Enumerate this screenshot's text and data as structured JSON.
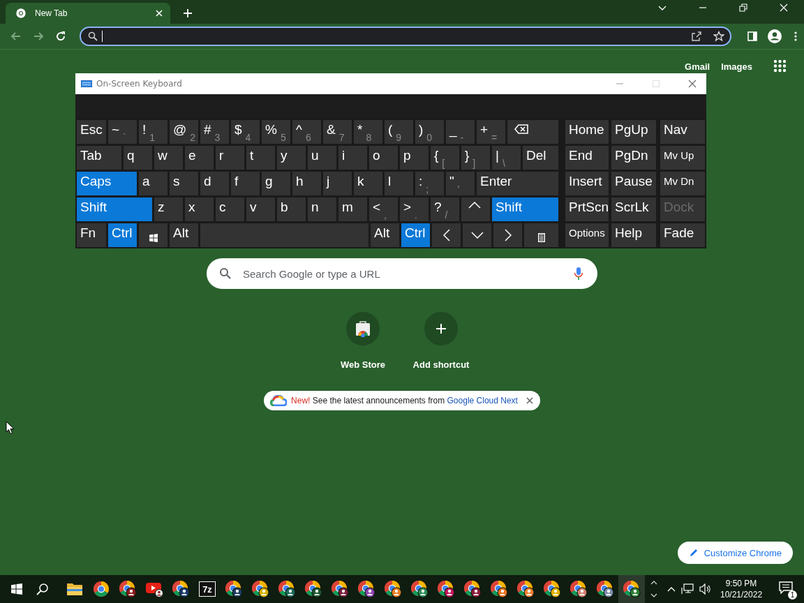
{
  "browser": {
    "tabs": [
      {
        "title": "New Tab",
        "selected": true
      }
    ]
  },
  "new_tab_page": {
    "header_links": [
      "Gmail",
      "Images"
    ],
    "search": {
      "placeholder": "Search Google or type a URL"
    },
    "shortcuts": [
      {
        "label": "Web Store",
        "kind": "webstore"
      },
      {
        "label": "Add shortcut",
        "kind": "add"
      }
    ],
    "promo": {
      "badge": "New!",
      "text": "See the latest announcements from",
      "link": "Google Cloud Next"
    },
    "customize_button": "Customize Chrome"
  },
  "on_screen_keyboard": {
    "title": "On-Screen Keyboard",
    "rows": [
      {
        "keys": [
          {
            "kind": "text",
            "label": "Esc",
            "pressed": false
          },
          {
            "kind": "text",
            "label": "~",
            "sub": "`",
            "pressed": false
          },
          {
            "kind": "text",
            "label": "!",
            "sub": "1",
            "pressed": false
          },
          {
            "kind": "text",
            "label": "@",
            "sub": "2",
            "pressed": false
          },
          {
            "kind": "text",
            "label": "#",
            "sub": "3",
            "pressed": false
          },
          {
            "kind": "text",
            "label": "$",
            "sub": "4",
            "pressed": false
          },
          {
            "kind": "text",
            "label": "%",
            "sub": "5",
            "pressed": false
          },
          {
            "kind": "text",
            "label": "^",
            "sub": "6",
            "pressed": false
          },
          {
            "kind": "text",
            "label": "&",
            "sub": "7",
            "pressed": false
          },
          {
            "kind": "text",
            "label": "*",
            "sub": "8",
            "pressed": false
          },
          {
            "kind": "text",
            "label": "(",
            "sub": "9",
            "pressed": false
          },
          {
            "kind": "text",
            "label": ")",
            "sub": "0",
            "pressed": false
          },
          {
            "kind": "text",
            "label": "_",
            "sub": "-",
            "pressed": false
          },
          {
            "kind": "text",
            "label": "+",
            "sub": "=",
            "pressed": false
          },
          {
            "kind": "backspace",
            "pressed": false
          }
        ]
      },
      {
        "keys": [
          {
            "kind": "text",
            "label": "Tab",
            "pressed": false
          },
          {
            "kind": "text",
            "label": "q",
            "pressed": false
          },
          {
            "kind": "text",
            "label": "w",
            "pressed": false
          },
          {
            "kind": "text",
            "label": "e",
            "pressed": false
          },
          {
            "kind": "text",
            "label": "r",
            "pressed": false
          },
          {
            "kind": "text",
            "label": "t",
            "pressed": false
          },
          {
            "kind": "text",
            "label": "y",
            "pressed": false
          },
          {
            "kind": "text",
            "label": "u",
            "pressed": false
          },
          {
            "kind": "text",
            "label": "i",
            "pressed": false
          },
          {
            "kind": "text",
            "label": "o",
            "pressed": false
          },
          {
            "kind": "text",
            "label": "p",
            "pressed": false
          },
          {
            "kind": "text",
            "label": "{",
            "sub": "[",
            "pressed": false
          },
          {
            "kind": "text",
            "label": "}",
            "sub": "]",
            "pressed": false
          },
          {
            "kind": "text",
            "label": "|",
            "sub": "\\",
            "pressed": false
          },
          {
            "kind": "text",
            "label": "Del",
            "pressed": false
          }
        ]
      },
      {
        "keys": [
          {
            "kind": "text",
            "label": "Caps",
            "pressed": true
          },
          {
            "kind": "text",
            "label": "a",
            "pressed": false
          },
          {
            "kind": "text",
            "label": "s",
            "pressed": false
          },
          {
            "kind": "text",
            "label": "d",
            "pressed": false
          },
          {
            "kind": "text",
            "label": "f",
            "pressed": false
          },
          {
            "kind": "text",
            "label": "g",
            "pressed": false
          },
          {
            "kind": "text",
            "label": "h",
            "pressed": false
          },
          {
            "kind": "text",
            "label": "j",
            "pressed": false
          },
          {
            "kind": "text",
            "label": "k",
            "pressed": false
          },
          {
            "kind": "text",
            "label": "l",
            "pressed": false
          },
          {
            "kind": "text",
            "label": ":",
            "sub": ";",
            "pressed": false
          },
          {
            "kind": "text",
            "label": "\"",
            "sub": "'",
            "pressed": false
          },
          {
            "kind": "text",
            "label": "Enter",
            "pressed": false
          }
        ]
      },
      {
        "keys": [
          {
            "kind": "text",
            "label": "Shift",
            "pressed": true
          },
          {
            "kind": "text",
            "label": "z",
            "pressed": false
          },
          {
            "kind": "text",
            "label": "x",
            "pressed": false
          },
          {
            "kind": "text",
            "label": "c",
            "pressed": false
          },
          {
            "kind": "text",
            "label": "v",
            "pressed": false
          },
          {
            "kind": "text",
            "label": "b",
            "pressed": false
          },
          {
            "kind": "text",
            "label": "n",
            "pressed": false
          },
          {
            "kind": "text",
            "label": "m",
            "pressed": false
          },
          {
            "kind": "text",
            "label": "<",
            "sub": ",",
            "pressed": false
          },
          {
            "kind": "text",
            "label": ">",
            "sub": ".",
            "pressed": false
          },
          {
            "kind": "text",
            "label": "?",
            "sub": "/",
            "pressed": false
          },
          {
            "kind": "up",
            "pressed": false
          },
          {
            "kind": "text",
            "label": "Shift",
            "pressed": true
          }
        ]
      },
      {
        "keys": [
          {
            "kind": "text",
            "label": "Fn",
            "pressed": false
          },
          {
            "kind": "text",
            "label": "Ctrl",
            "pressed": true
          },
          {
            "kind": "windows",
            "pressed": false
          },
          {
            "kind": "text",
            "label": "Alt",
            "pressed": false
          },
          {
            "kind": "space",
            "pressed": false
          },
          {
            "kind": "text",
            "label": "Alt",
            "pressed": false
          },
          {
            "kind": "text",
            "label": "Ctrl",
            "pressed": true
          },
          {
            "kind": "left",
            "pressed": false
          },
          {
            "kind": "down",
            "pressed": false
          },
          {
            "kind": "right",
            "pressed": false
          },
          {
            "kind": "menu",
            "pressed": false
          }
        ]
      }
    ],
    "nav_rows": [
      [
        {
          "kind": "text",
          "label": "Home",
          "disabled": false
        },
        {
          "kind": "text",
          "label": "PgUp",
          "disabled": false
        },
        {
          "kind": "text",
          "label": "Nav",
          "disabled": false
        }
      ],
      [
        {
          "kind": "text",
          "label": "End",
          "disabled": false
        },
        {
          "kind": "text",
          "label": "PgDn",
          "disabled": false
        },
        {
          "kind": "small",
          "label": "Mv Up",
          "disabled": false
        }
      ],
      [
        {
          "kind": "text",
          "label": "Insert",
          "disabled": false
        },
        {
          "kind": "text",
          "label": "Pause",
          "disabled": false
        },
        {
          "kind": "small",
          "label": "Mv Dn",
          "disabled": false
        }
      ],
      [
        {
          "kind": "text",
          "label": "PrtScn",
          "disabled": false
        },
        {
          "kind": "text",
          "label": "ScrLk",
          "disabled": false
        },
        {
          "kind": "text",
          "label": "Dock",
          "disabled": true
        }
      ],
      [
        {
          "kind": "small",
          "label": "Options",
          "disabled": false
        },
        {
          "kind": "text",
          "label": "Help",
          "disabled": false
        },
        {
          "kind": "text",
          "label": "Fade",
          "disabled": false
        }
      ]
    ]
  },
  "taskbar": {
    "apps": [
      {
        "kind": "folder",
        "selected": false
      },
      {
        "kind": "browser",
        "selected": false
      },
      {
        "kind": "profile",
        "color": "#8b1a1a",
        "selected": false
      },
      {
        "kind": "video",
        "selected": false
      },
      {
        "kind": "profile",
        "color": "#1a3a6b",
        "selected": false
      },
      {
        "kind": "archive",
        "label": "7z",
        "selected": false
      },
      {
        "kind": "profile",
        "color": "#1e3a5f",
        "selected": false
      },
      {
        "kind": "profile",
        "color": "#d4b000",
        "selected": false
      },
      {
        "kind": "profile",
        "color": "#1b6b5a",
        "selected": false
      },
      {
        "kind": "profile",
        "color": "#1e5631",
        "selected": false
      },
      {
        "kind": "profile",
        "color": "#7a1f3d",
        "selected": false
      },
      {
        "kind": "profile",
        "color": "#8e44ad",
        "selected": false
      },
      {
        "kind": "profile",
        "color": "#e67e22",
        "selected": false
      },
      {
        "kind": "profile",
        "color": "#2e8b57",
        "selected": false
      },
      {
        "kind": "profile",
        "color": "#c2185b",
        "selected": false
      },
      {
        "kind": "profile",
        "color": "#8b1a3a",
        "selected": false
      },
      {
        "kind": "profile",
        "color": "#e8711c",
        "selected": false
      },
      {
        "kind": "profile",
        "color": "#f08030",
        "selected": false
      },
      {
        "kind": "profile",
        "color": "#e0b000",
        "selected": false
      },
      {
        "kind": "profile",
        "color": "#d08070",
        "selected": false
      },
      {
        "kind": "profile",
        "color": "#7a8cab",
        "selected": false
      },
      {
        "kind": "profile",
        "color": "#2e7d32",
        "selected": true
      }
    ],
    "clock": {
      "time": "9:50 PM",
      "date": "10/21/2022"
    },
    "notification_count": "1"
  }
}
